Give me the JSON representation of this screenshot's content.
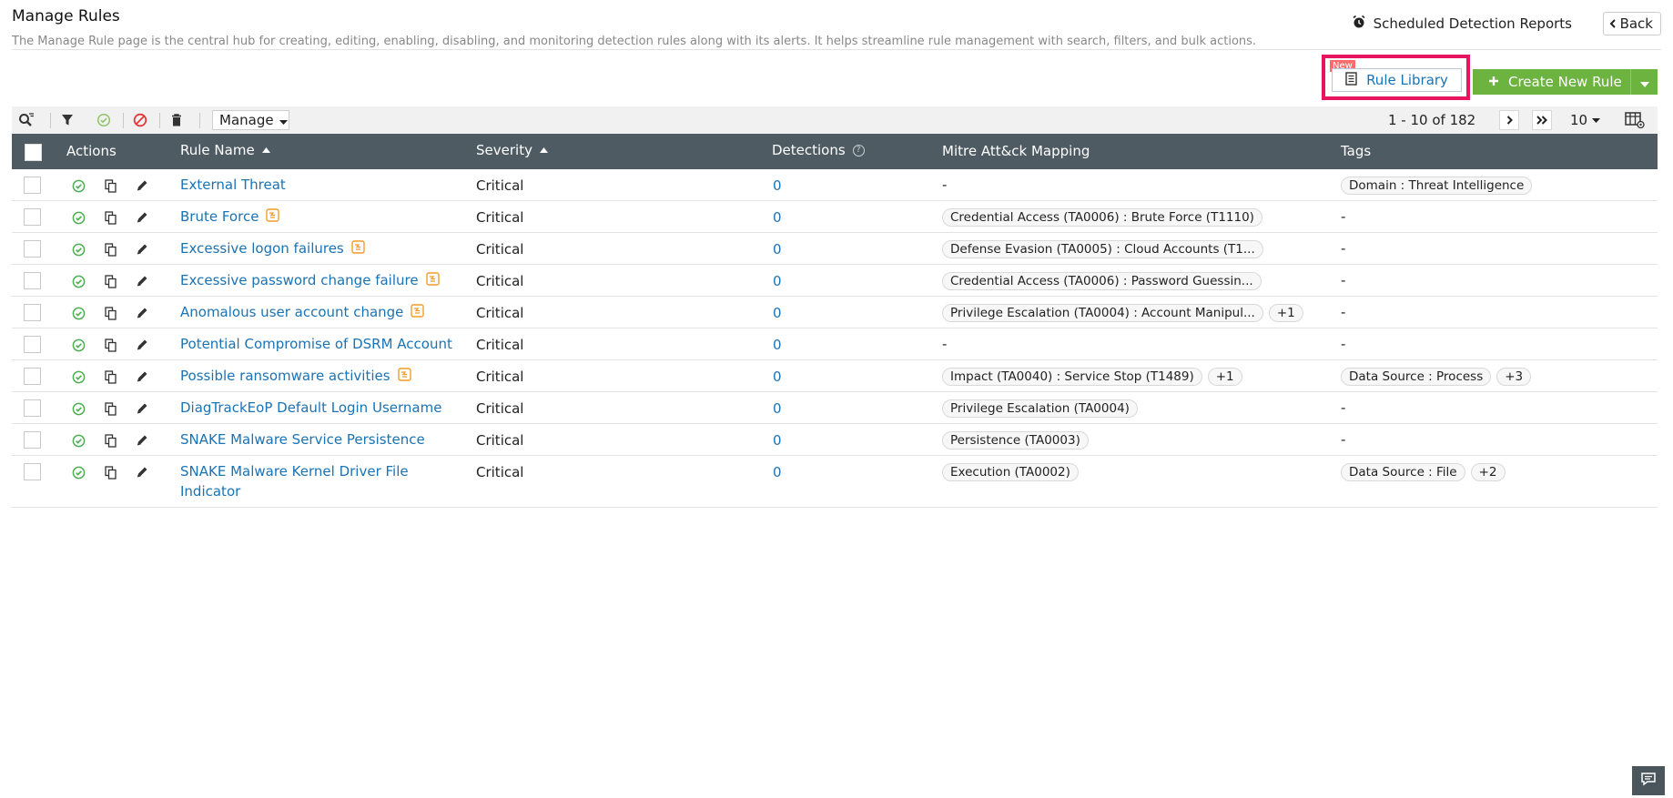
{
  "header": {
    "title": "Manage Rules",
    "description": "The Manage Rule page is the central hub for creating, editing, enabling, disabling, and monitoring detection rules along with its alerts. It helps streamline rule management with search, filters, and bulk actions.",
    "scheduled_reports": "Scheduled Detection Reports",
    "back": "Back"
  },
  "actions": {
    "new_badge": "New",
    "rule_library": "Rule Library",
    "create_new_rule": "Create New Rule"
  },
  "toolbar": {
    "manage": "Manage",
    "pagination": "1 - 10 of 182",
    "per_page": "10"
  },
  "columns": {
    "actions": "Actions",
    "rule_name": "Rule Name",
    "severity": "Severity",
    "detections": "Detections",
    "mitre": "Mitre Att&ck Mapping",
    "tags": "Tags"
  },
  "rows": [
    {
      "name": "External Threat",
      "severity": "Critical",
      "detections": "0",
      "mitre": [],
      "mitre_dash": "-",
      "tags": [
        "Domain : Threat Intelligence"
      ],
      "tags_dash": ""
    },
    {
      "name": "Brute Force",
      "severity": "Critical",
      "detections": "0",
      "mitre": [
        "Credential Access (TA0006) : Brute Force (T1110)"
      ],
      "mitre_dash": "",
      "tags": [],
      "tags_dash": "-"
    },
    {
      "name": "Excessive logon failures",
      "severity": "Critical",
      "detections": "0",
      "mitre": [
        "Defense Evasion (TA0005) : Cloud Accounts (T1..."
      ],
      "mitre_dash": "",
      "tags": [],
      "tags_dash": "-"
    },
    {
      "name": "Excessive password change failure",
      "severity": "Critical",
      "detections": "0",
      "mitre": [
        "Credential Access (TA0006) : Password Guessin..."
      ],
      "mitre_dash": "",
      "tags": [],
      "tags_dash": "-"
    },
    {
      "name": "Anomalous user account change",
      "severity": "Critical",
      "detections": "0",
      "mitre": [
        "Privilege Escalation (TA0004) : Account Manipul...",
        "+1"
      ],
      "mitre_dash": "",
      "tags": [],
      "tags_dash": "-"
    },
    {
      "name": "Potential Compromise of DSRM Account",
      "severity": "Critical",
      "detections": "0",
      "mitre": [],
      "mitre_dash": "-",
      "tags": [],
      "tags_dash": "-"
    },
    {
      "name": "Possible ransomware activities",
      "severity": "Critical",
      "detections": "0",
      "mitre": [
        "Impact (TA0040) : Service Stop (T1489)",
        "+1"
      ],
      "mitre_dash": "",
      "tags": [
        "Data Source : Process",
        "+3"
      ],
      "tags_dash": ""
    },
    {
      "name": "DiagTrackEoP Default Login Username",
      "severity": "Critical",
      "detections": "0",
      "mitre": [
        "Privilege Escalation (TA0004)"
      ],
      "mitre_dash": "",
      "tags": [],
      "tags_dash": "-"
    },
    {
      "name": "SNAKE Malware Service Persistence",
      "severity": "Critical",
      "detections": "0",
      "mitre": [
        "Persistence (TA0003)"
      ],
      "mitre_dash": "",
      "tags": [],
      "tags_dash": "-"
    },
    {
      "name": "SNAKE Malware Kernel Driver File Indicator",
      "severity": "Critical",
      "detections": "0",
      "mitre": [
        "Execution (TA0002)"
      ],
      "mitre_dash": "",
      "tags": [
        "Data Source : File",
        "+2"
      ],
      "tags_dash": ""
    }
  ],
  "colors": {
    "accent_link": "#1a73b5",
    "create_green": "#6db33f",
    "highlight": "#e8155e",
    "header_bg": "#4f5b63",
    "enabled_green": "#4caf50",
    "type_icon_orange": "#f39c2a"
  }
}
